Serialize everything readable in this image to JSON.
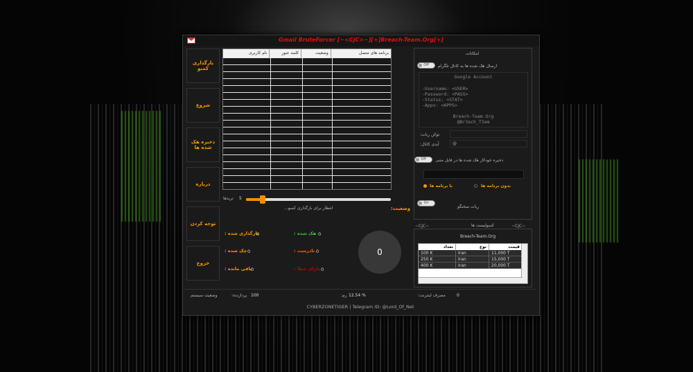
{
  "window": {
    "title": "Gmail BruteForcer [~<CjC>~][+]Breach-Team.Org[+]",
    "footer": "CYBERZONETIGER | Telegram ID: @Lord_Of_Net"
  },
  "sidebar": {
    "items": [
      {
        "label": "بارگذاری کمبو"
      },
      {
        "label": "شروع"
      },
      {
        "label": "ذخیره هک شده ها"
      },
      {
        "label": "درباره"
      },
      {
        "label": "توجه کردن"
      },
      {
        "label": "خروج"
      }
    ]
  },
  "grid": {
    "columns": [
      "برنامه های متصل",
      "وضعیت",
      "کلمه عبور",
      "نام کاربری"
    ]
  },
  "threads": {
    "label": "تریدها",
    "value": "5"
  },
  "status": {
    "label": "وضعیت:",
    "text": "انتظار برای بارگذاری کمبو..."
  },
  "stats": {
    "loaded_label": "بارگذاری شده :",
    "loaded_value": "0",
    "checked_label": "چک شده :",
    "checked_value": "0",
    "remaining_label": "باقی مانده :",
    "remaining_value": "0",
    "hacked_label": "هک شده :",
    "hacked_value": "0",
    "invalid_label": "نادرست :",
    "invalid_value": "0",
    "error_label": "دارای خطا :",
    "error_value": "0",
    "counter": "0"
  },
  "features": {
    "title": "امکانات",
    "telegram_label": "ارسال هک شده ها به کانال تلگرام",
    "toggle_off": "Off",
    "template": {
      "heading": "Google Account",
      "line1": "-Username: <USER>",
      "line2": "-Password: <PASS>",
      "line3": "-Status: <STAT>",
      "line4": "-Apps: <APPS>",
      "footer1": "Breach-Team.Org",
      "footer2": "@Br3ach_T3am"
    },
    "bot_token_label": "توکن ربات:",
    "channel_id_label": "آیدی کانال:",
    "channel_id_value": "@",
    "autosave_label": "ذخیره خودکار هک شده ها در فایل متنی",
    "with_apps_label": "با برنامه ها",
    "without_apps_label": "بدون برنامه ها",
    "bot_tester_label": "ربات سخنگو",
    "toggle_on": "On"
  },
  "combolist": {
    "title": "کمبولیست ها",
    "left_tag": "~CjC~",
    "right_tag": "~CjC~",
    "site": "Breach-Team.Org",
    "columns": [
      "تعداد",
      "نوع",
      "قیمت"
    ],
    "rows": [
      [
        "100 K",
        "Iran",
        "11,000 T"
      ],
      [
        "250 K",
        "Iran",
        "15,000 T"
      ],
      [
        "400 K",
        "Iran",
        "20,000 T"
      ]
    ]
  },
  "statusbar": {
    "system_label": "وضعیت سیستم",
    "processor_label": "پردازنده:",
    "processor_value": "100",
    "ram_label": "رم:",
    "ram_value": "12.54 %",
    "internet_label": "مصرف اینترنت:",
    "internet_value": "0"
  },
  "colors": {
    "title": "#e01010",
    "accent": "#ff9900",
    "hacked": "#33cc33",
    "invalid": "#ff6600",
    "error": "#cc0000"
  }
}
